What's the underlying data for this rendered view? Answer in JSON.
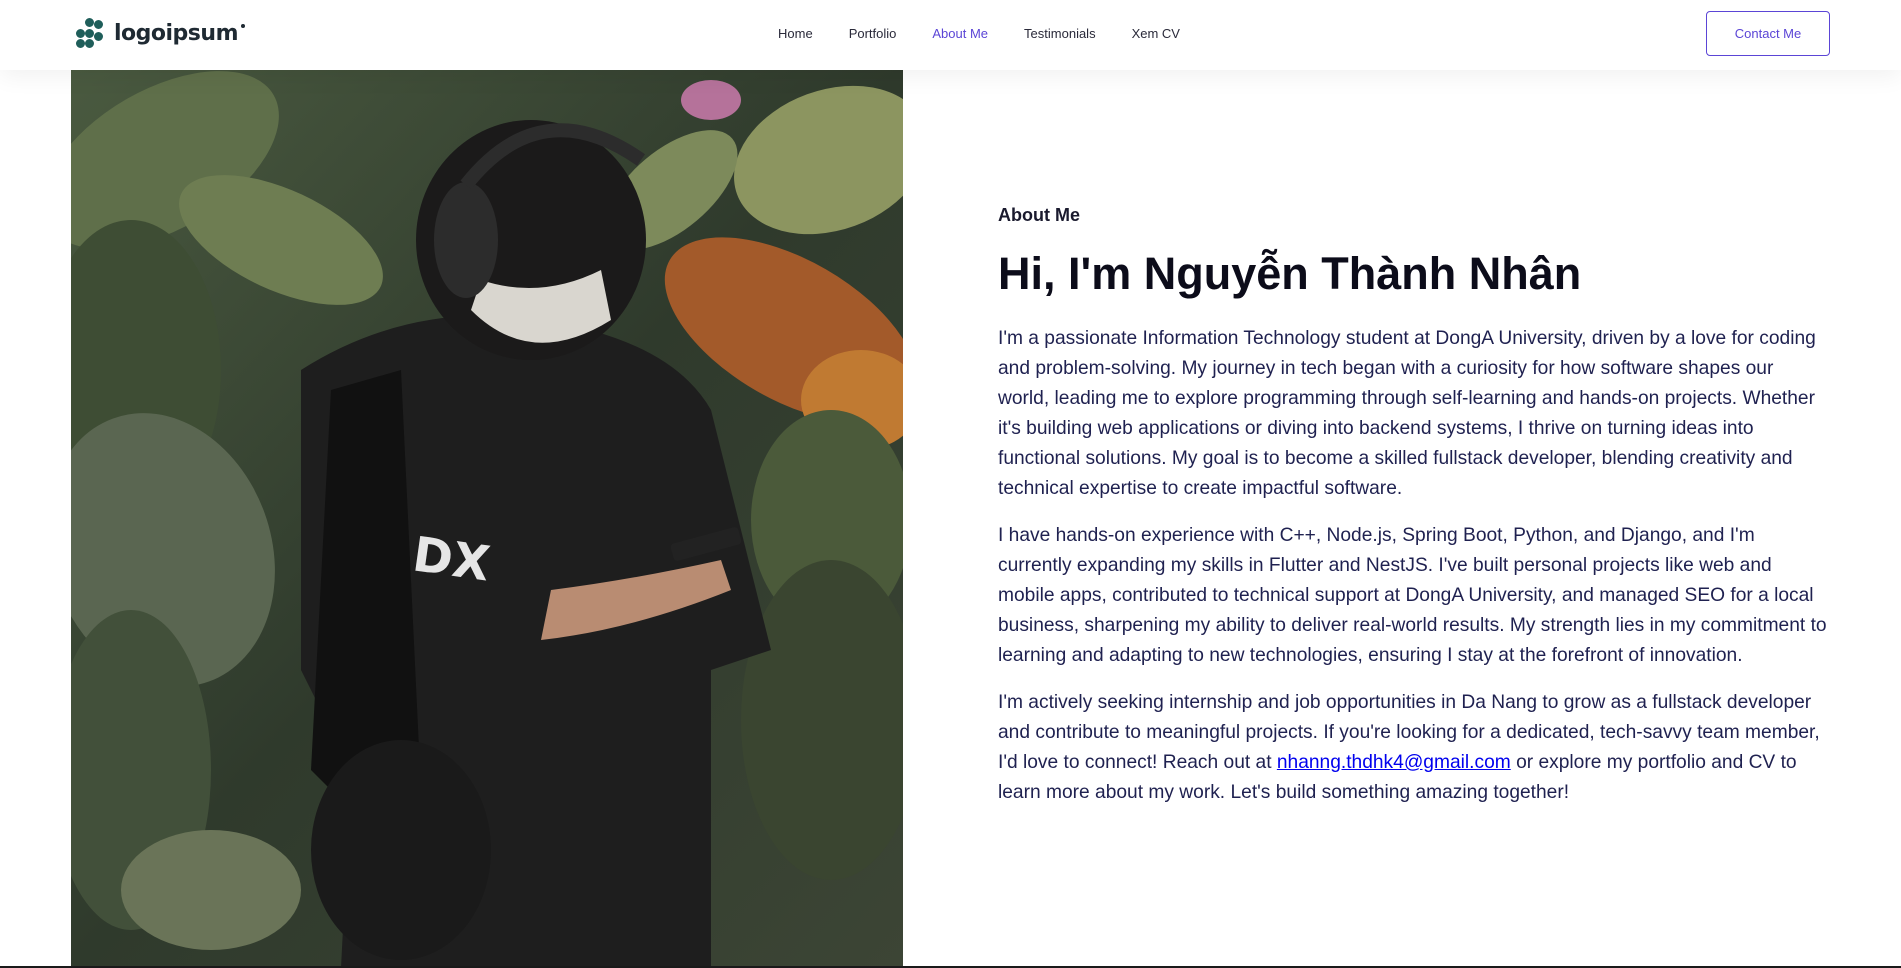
{
  "brand": {
    "name": "logoipsum",
    "icon": "logo-icon",
    "color": "#1f5e5a"
  },
  "nav": {
    "items": [
      {
        "label": "Home"
      },
      {
        "label": "Portfolio"
      },
      {
        "label": "About Me"
      },
      {
        "label": "Testimonials"
      },
      {
        "label": "Xem CV"
      }
    ],
    "active_index": 2,
    "accent_color": "#5b45d6"
  },
  "header": {
    "contact_label": "Contact Me"
  },
  "about": {
    "eyebrow": "About Me",
    "title": "Hi, I'm Nguyễn Thành Nhân",
    "para1": "I'm a passionate Information Technology student at DongA University, driven by a love for coding and problem-solving. My journey in tech began with a curiosity for how software shapes our world, leading me to explore programming through self-learning and hands-on projects. Whether it's building web applications or diving into backend systems, I thrive on turning ideas into functional solutions. My goal is to become a skilled fullstack developer, blending creativity and technical expertise to create impactful software.",
    "para2": "I have hands-on experience with C++, Node.js, Spring Boot, Python, and Django, and I'm currently expanding my skills in Flutter and NestJS. I've built personal projects like web and mobile apps, contributed to technical support at DongA University, and managed SEO for a local business, sharpening my ability to deliver real-world results. My strength lies in my commitment to learning and adapting to new technologies, ensuring I stay at the forefront of innovation.",
    "para3_before": "I'm actively seeking internship and job opportunities in Da Nang to grow as a fullstack developer and contribute to meaningful projects. If you're looking for a dedicated, tech-savvy team member, I'd love to connect! Reach out at ",
    "email": "nhanng.thdhk4@gmail.com",
    "para3_after": " or explore my portfolio and CV to learn more about my work. Let's build something amazing together!"
  },
  "photo": {
    "alt": "portrait-photo"
  }
}
